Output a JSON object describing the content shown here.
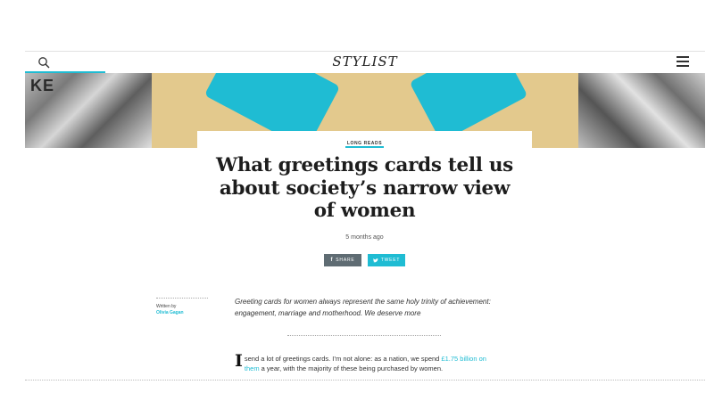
{
  "header": {
    "logo": "STYLIST",
    "search_icon": "search-icon",
    "menu_icon": "hamburger-menu-icon",
    "accent_color": "#1fbcd3"
  },
  "hero": {
    "sign_text": "KE"
  },
  "article": {
    "category": "LONG READS",
    "headline_line1": "What greetings cards tell us",
    "headline_line2": "about society’s narrow view",
    "headline_line3": "of women",
    "date": "5 months ago",
    "share_label": "SHARE",
    "tweet_label": "TWEET",
    "author_label": "Written by",
    "author_name": "Olivia Gagan",
    "standfirst": "Greeting cards for women always represent the same holy trinity of achievement: engagement, marriage and motherhood. We deserve more",
    "body": {
      "dropcap": "I",
      "text_before_link": " send a lot of greetings cards. I’m not alone: as a nation, we spend ",
      "link_text": "£1.75 billion on them",
      "text_after_link": " a year, with the majority of these being purchased by women."
    }
  }
}
